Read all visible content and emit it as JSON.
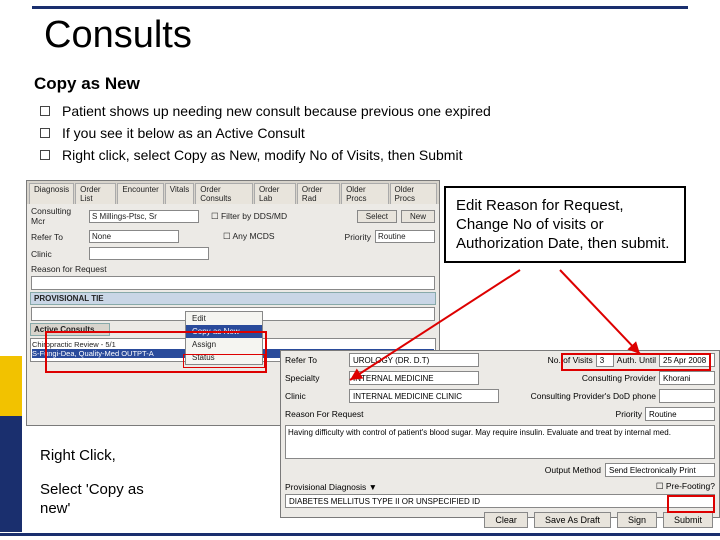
{
  "title": "Consults",
  "subtitle": "Copy as New",
  "bullets": [
    "Patient shows up needing new consult because previous one expired",
    "If you see it below as an Active Consult",
    "Right click, select Copy as New, modify No of Visits, then Submit"
  ],
  "shot1": {
    "tabs": [
      "Diagnosis",
      "Order List",
      "Encounter",
      "Vitals",
      "Order Consults",
      "Order Lab",
      "Order Rad",
      "Older Procs",
      "Older Procs"
    ],
    "consulting_label": "Consulting Mcr",
    "consulting_val": "S Millings-Ptsc, Sr",
    "dob_cb": "Filter by DDS/MD",
    "btn_select": "Select",
    "btn_new": "New",
    "refer_lbl": "Refer To",
    "refer_val": "None",
    "prov_cb": "Any MCDS",
    "priority_lbl": "Priority",
    "priority_val": "Routine",
    "clinic_lbl": "Clinic",
    "reason_lbl": "Reason for Request",
    "ac": "Active Consults",
    "list1": "Chiropractic Review - 5/1",
    "list2": "S-Fungi-Dea, Quality-Med OUTPT-A",
    "prov_hdr": "PROVISIONAL TIE",
    "ctx": {
      "edit": "Edit",
      "copy": "Copy as New",
      "assign": "Assign",
      "status": "Status"
    }
  },
  "shot2": {
    "refer_lbl": "Refer To",
    "refer_val": "UROLOGY (DR. D.T)",
    "spec_lbl": "Specialty",
    "spec_val": "INTERNAL MEDICINE",
    "clinic_lbl": "Clinic",
    "clinic_val": "INTERNAL MEDICINE CLINIC",
    "novisits_lbl": "No. of Visits",
    "novisits_val": "3",
    "auth_lbl": "Auth. Until",
    "auth_val": "25 Apr 2008",
    "consprov_lbl": "Consulting Provider",
    "consprov_val": "Khorani",
    "phone_lbl": "Consulting Provider's DoD phone",
    "priority_lbl": "Priority",
    "priority_val": "Routine",
    "out_lbl": "Output Method",
    "out_val": "Send Electronically Print",
    "prefoot_cb": "Pre-Footing?",
    "reason_lbl": "Reason For Request",
    "reason_txt": "Having difficulty with control of patient's blood sugar. May require insulin. Evaluate and treat by internal med.",
    "provdx_lbl": "Provisional Diagnosis ▼",
    "provdx_val": "DIABETES MELLITUS TYPE II OR UNSPECIFIED   ID",
    "btns": {
      "clear": "Clear",
      "draft": "Save As Draft",
      "sign": "Sign",
      "submit": "Submit"
    }
  },
  "callout": "Edit Reason for Request, Change No of visits or Authorization Date, then submit.",
  "caption1": "Right Click,",
  "caption2": "Select 'Copy as new'"
}
